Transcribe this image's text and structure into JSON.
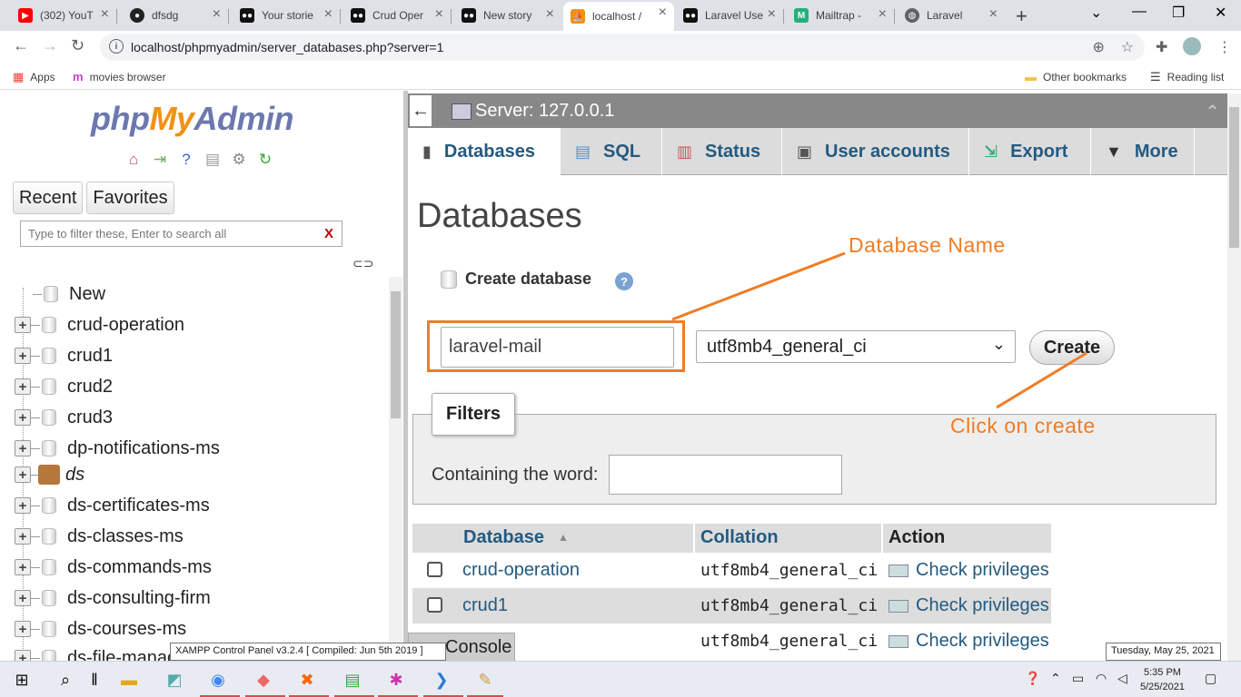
{
  "browser": {
    "tabs": [
      {
        "label": "(302) YouT",
        "favicon": "youtube-icon",
        "color": "#ff0000"
      },
      {
        "label": "dfsdg",
        "favicon": "github-icon",
        "color": "#222222"
      },
      {
        "label": "Your storie",
        "favicon": "medium-icon",
        "color": "#111111"
      },
      {
        "label": "Crud Oper",
        "favicon": "medium-icon",
        "color": "#111111"
      },
      {
        "label": "New story",
        "favicon": "medium-icon",
        "color": "#111111"
      },
      {
        "label": "localhost /",
        "favicon": "phpmyadmin-icon",
        "color": "#f29111"
      },
      {
        "label": "Laravel Use",
        "favicon": "medium-icon",
        "color": "#111111"
      },
      {
        "label": "Mailtrap -",
        "favicon": "mailtrap-icon",
        "color": "#22b07d"
      },
      {
        "label": "Laravel",
        "favicon": "globe-icon",
        "color": "#5f6368"
      }
    ],
    "url": "localhost/phpmyadmin/server_databases.php?server=1",
    "bookmarks": {
      "apps": "Apps",
      "movies": "movies browser",
      "other": "Other bookmarks",
      "reading": "Reading list"
    }
  },
  "nav": {
    "logo": {
      "php": "php",
      "my": "My",
      "admin": "Admin"
    },
    "tabs": [
      "Recent",
      "Favorites"
    ],
    "filter_placeholder": "Type to filter these, Enter to search all",
    "filter_clear": "X",
    "tree": [
      {
        "label": "New"
      },
      {
        "label": "crud-operation"
      },
      {
        "label": "crud1"
      },
      {
        "label": "crud2"
      },
      {
        "label": "crud3"
      },
      {
        "label": "dp-notifications-ms"
      },
      {
        "label": "ds"
      },
      {
        "label": "ds-certificates-ms"
      },
      {
        "label": "ds-classes-ms"
      },
      {
        "label": "ds-commands-ms"
      },
      {
        "label": "ds-consulting-firm"
      },
      {
        "label": "ds-courses-ms"
      },
      {
        "label": "ds-file-manag"
      }
    ]
  },
  "server": {
    "title": "Server: 127.0.0.1",
    "menu": [
      "Databases",
      "SQL",
      "Status",
      "User accounts",
      "Export",
      "More"
    ]
  },
  "page": {
    "title": "Databases",
    "create_header": "Create database",
    "db_name_value": "laravel-mail",
    "collation_value": "utf8mb4_general_ci",
    "create_button": "Create",
    "filters_legend": "Filters",
    "containing_label": "Containing the word:",
    "table": {
      "headers": [
        "Database",
        "Collation",
        "Action"
      ],
      "rows": [
        {
          "name": "crud-operation",
          "collation": "utf8mb4_general_ci",
          "action": "Check privileges"
        },
        {
          "name": "crud1",
          "collation": "utf8mb4_general_ci",
          "action": "Check privileges"
        },
        {
          "name": "",
          "collation": "utf8mb4_general_ci",
          "action": "Check privileges"
        }
      ]
    },
    "console": "Console"
  },
  "annotations": {
    "db_name": "Database Name",
    "click_create": "Click on create",
    "color": "#f07c24"
  },
  "taskbar": {
    "tooltip": "XAMPP Control Panel v3.2.4   [ Compiled: Jun 5th 2019 ]",
    "date_tooltip": "Tuesday, May 25, 2021",
    "time": "5:35 PM",
    "date": "5/25/2021"
  }
}
